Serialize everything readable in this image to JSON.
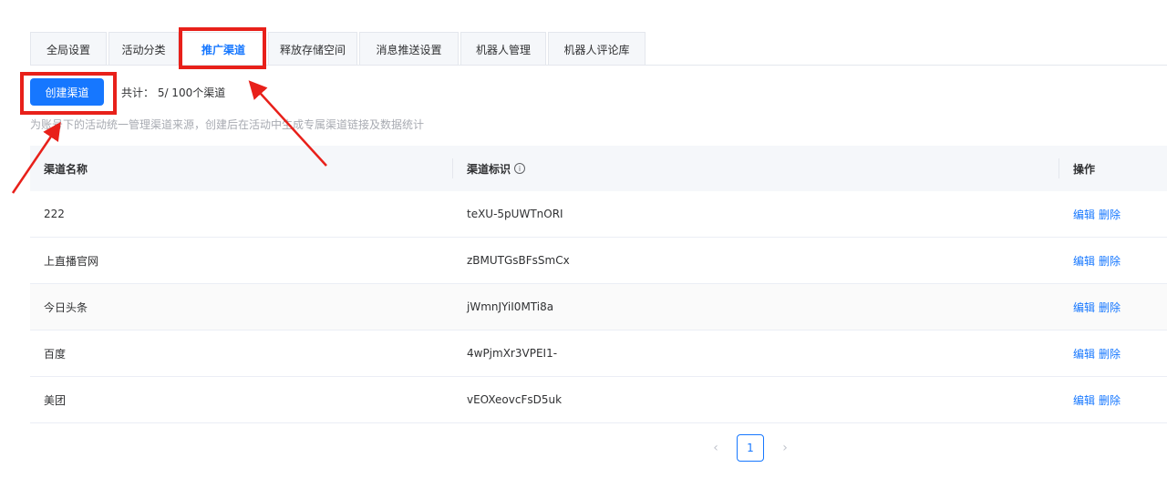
{
  "tabs": [
    {
      "label": "全局设置",
      "active": false
    },
    {
      "label": "活动分类",
      "active": false
    },
    {
      "label": "推广渠道",
      "active": true
    },
    {
      "label": "释放存储空间",
      "active": false
    },
    {
      "label": "消息推送设置",
      "active": false
    },
    {
      "label": "机器人管理",
      "active": false
    },
    {
      "label": "机器人评论库",
      "active": false
    }
  ],
  "toolbar": {
    "create_label": "创建渠道",
    "total_text": "共计： 5/ 100个渠道"
  },
  "description": "为账号下的活动统一管理渠道来源，创建后在活动中生成专属渠道链接及数据统计",
  "table": {
    "columns": [
      "渠道名称",
      "渠道标识",
      "操作"
    ],
    "rows": [
      {
        "name": "222",
        "code": "teXU-5pUWTnORI"
      },
      {
        "name": "上直播官网",
        "code": "zBMUTGsBFsSmCx"
      },
      {
        "name": "今日头条",
        "code": "jWmnJYiI0MTi8a"
      },
      {
        "name": "百度",
        "code": "4wPjmXr3VPEI1-"
      },
      {
        "name": "美团",
        "code": "vEOXeovcFsD5uk"
      }
    ],
    "edit_label": "编辑",
    "delete_label": "删除"
  },
  "pagination": {
    "current_page": "1",
    "prev_glyph": "‹",
    "next_glyph": "›"
  },
  "colors": {
    "accent": "#1677ff",
    "annotation": "#e8201a"
  }
}
